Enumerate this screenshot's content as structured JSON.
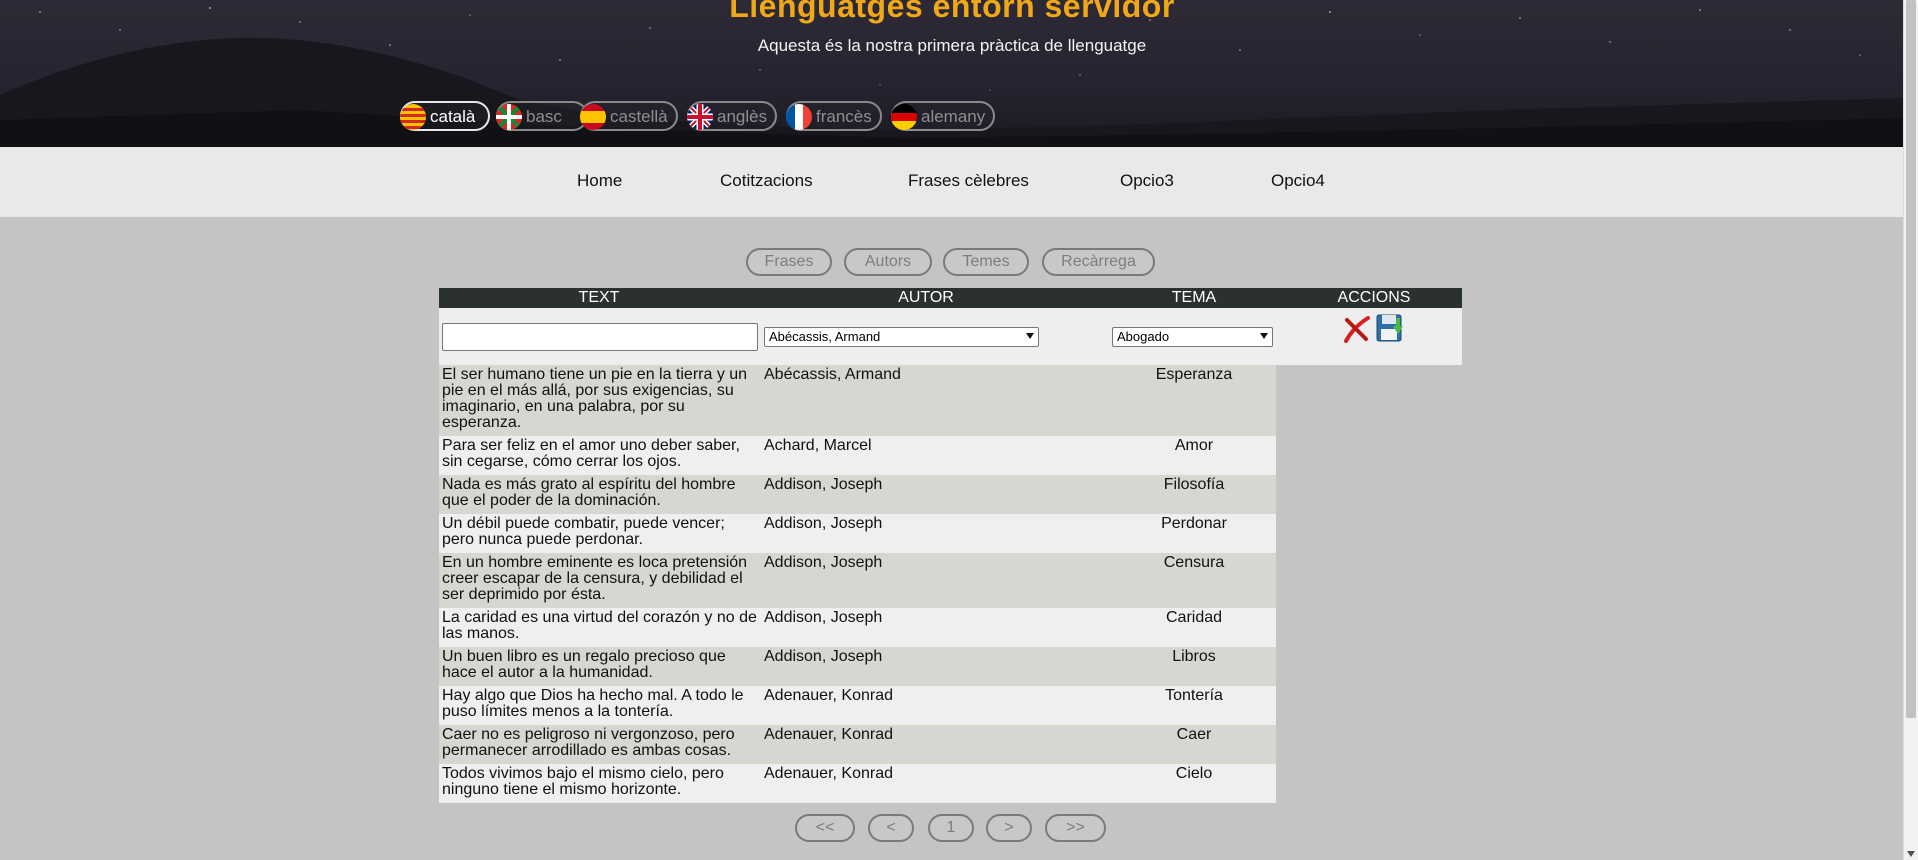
{
  "header": {
    "title": "Llenguatges entorn servidor",
    "subtitle": "Aquesta és la nostra primera pràctica de llenguatge",
    "languages": [
      {
        "label": "català",
        "flag": "catalonia"
      },
      {
        "label": "basc",
        "flag": "basque"
      },
      {
        "label": "castellà",
        "flag": "spain"
      },
      {
        "label": "anglès",
        "flag": "uk"
      },
      {
        "label": "francès",
        "flag": "france"
      },
      {
        "label": "alemany",
        "flag": "germany"
      }
    ]
  },
  "nav": {
    "items": [
      "Home",
      "Cotitzacions",
      "Frases cèlebres",
      "Opcio3",
      "Opcio4"
    ]
  },
  "section_buttons": [
    "Frases",
    "Autors",
    "Temes",
    "Recàrrega"
  ],
  "table": {
    "headers": {
      "text": "TEXT",
      "autor": "AUTOR",
      "tema": "TEMA",
      "accions": "ACCIONS"
    },
    "filter": {
      "text_value": "",
      "autor_selected": "Abécassis, Armand",
      "tema_selected": "Abogado"
    },
    "rows": [
      {
        "text": "El ser humano tiene un pie en la tierra y un pie en el más allá, por sus exigencias, su imaginario, en una palabra, por su esperanza.",
        "autor": "Abécassis, Armand",
        "tema": "Esperanza"
      },
      {
        "text": "Para ser feliz en el amor uno deber saber, sin cegarse, cómo cerrar los ojos.",
        "autor": "Achard, Marcel",
        "tema": "Amor"
      },
      {
        "text": "Nada es más grato al espíritu del hombre que el poder de la dominación.",
        "autor": "Addison, Joseph",
        "tema": "Filosofía"
      },
      {
        "text": "Un débil puede combatir, puede vencer; pero nunca puede perdonar.",
        "autor": "Addison, Joseph",
        "tema": "Perdonar"
      },
      {
        "text": "En un hombre eminente es loca pretensión creer escapar de la censura, y debilidad el ser deprimido por ésta.",
        "autor": "Addison, Joseph",
        "tema": "Censura"
      },
      {
        "text": "La caridad es una virtud del corazón y no de las manos.",
        "autor": "Addison, Joseph",
        "tema": "Caridad"
      },
      {
        "text": "Un buen libro es un regalo precioso que hace el autor a la humanidad.",
        "autor": "Addison, Joseph",
        "tema": "Libros"
      },
      {
        "text": "Hay algo que Dios ha hecho mal. A todo le puso límites menos a la tontería.",
        "autor": "Adenauer, Konrad",
        "tema": "Tontería"
      },
      {
        "text": "Caer no es peligroso ni vergonzoso, pero permanecer arrodillado es ambas cosas.",
        "autor": "Adenauer, Konrad",
        "tema": "Caer"
      },
      {
        "text": "Todos vivimos bajo el mismo cielo, pero ninguno tiene el mismo horizonte.",
        "autor": "Adenauer, Konrad",
        "tema": "Cielo"
      }
    ]
  },
  "pager": {
    "first": "<<",
    "prev": "<",
    "page": "1",
    "next": ">",
    "last": ">>"
  },
  "colors": {
    "title": "#f0a81a",
    "table_header": "#2b3131",
    "row_odd": "#d5d7d0",
    "row_even": "#efefef"
  }
}
